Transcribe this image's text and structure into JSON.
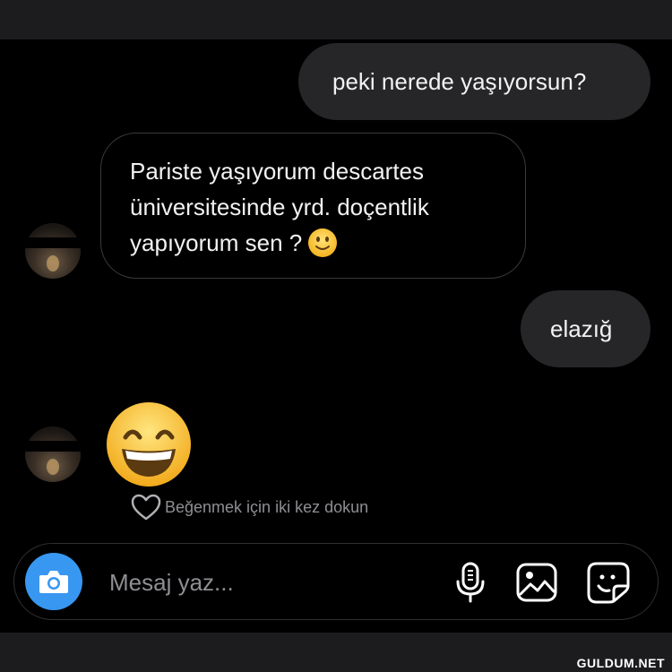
{
  "messages": {
    "sent_1": "peki nerede yaşıyorsun?",
    "received_1": {
      "lines": [
        "Pariste yaşıyorum descartes",
        "üniversitesinde yrd. doçentlik",
        "yapıyorum sen ?"
      ],
      "trailing_emoji": "slightly-smiling-face"
    },
    "sent_2": "elazığ",
    "received_2_emoji": "grinning-face-with-smiling-eyes"
  },
  "like_hint": "Beğenmek için iki kez dokun",
  "composer": {
    "placeholder": "Mesaj yaz...",
    "icons": [
      "camera-icon",
      "microphone-icon",
      "gallery-icon",
      "sticker-icon"
    ]
  },
  "watermark": "GULDUM.NET",
  "colors": {
    "background": "#000000",
    "sent_bubble": "#262628",
    "camera_button": "#3897f0",
    "muted_text": "#8e8e93"
  }
}
